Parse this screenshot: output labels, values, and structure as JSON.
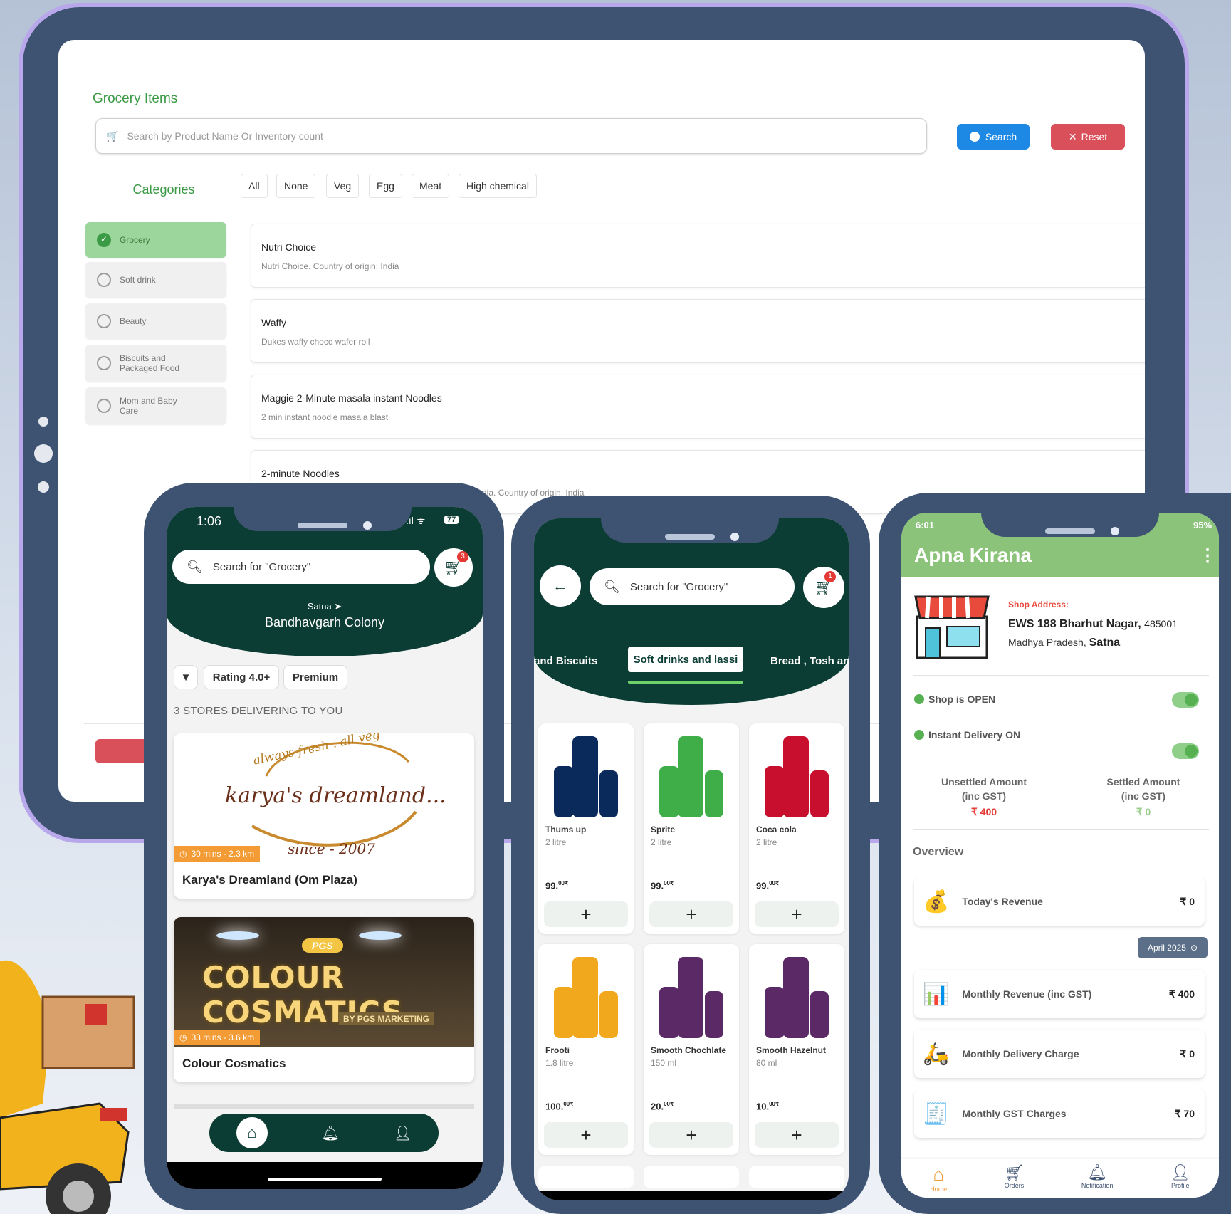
{
  "tablet": {
    "title": "Grocery Items",
    "search_placeholder": "Search by Product Name Or Inventory count",
    "search_button": "Search",
    "reset_button": "Reset",
    "categories_heading": "Categories",
    "categories": [
      {
        "label": "Grocery",
        "selected": true
      },
      {
        "label": "Soft drink",
        "selected": false
      },
      {
        "label": "Beauty",
        "selected": false
      },
      {
        "label": "Biscuits and Packaged Food",
        "selected": false
      },
      {
        "label": "Mom and Baby Care",
        "selected": false
      }
    ],
    "filter_chips": [
      "All",
      "None",
      "Veg",
      "Egg",
      "Meat",
      "High chemical"
    ],
    "products": [
      {
        "name": "Nutri Choice",
        "desc": "Nutri Choice. Country of origin: India"
      },
      {
        "name": "Waffy",
        "desc": "Dukes waffy choco wafer roll"
      },
      {
        "name": "Maggie 2-Minute masala instant Noodles",
        "desc": "2 min instant noodle masala blast"
      },
      {
        "name": "2-minute Noodles",
        "desc": "India. Country of origin: India"
      }
    ]
  },
  "phone1": {
    "time": "1:06",
    "battery": "77",
    "search_placeholder": "Search for \"Grocery\"",
    "cart_count": "3",
    "city": "Satna",
    "locality": "Bandhavgarh Colony",
    "filters": [
      "Rating 4.0+",
      "Premium"
    ],
    "stores_heading": "3 STORES DELIVERING TO YOU",
    "stores": [
      {
        "name": "Karya's Dreamland (Om Plaza)",
        "eta": "30 mins - 2.3 km",
        "logo_top": "always fresh . all veg",
        "logo_main": "karya's dreamland...",
        "logo_since": "since - 2007"
      },
      {
        "name": "Colour Cosmatics",
        "eta": "33 mins - 3.6 km",
        "sign_brand": "PGS",
        "sign_main": "COLOUR COSMATICS",
        "sign_sub": "BY PGS MARKETING"
      }
    ]
  },
  "phone2": {
    "search_placeholder": "Search for \"Grocery\"",
    "cart_count": "1",
    "tabs": [
      "and Biscuits",
      "Soft drinks and lassi",
      "Bread , Tosh and"
    ],
    "active_tab": "Soft drinks and lassi",
    "products": [
      {
        "name": "Thums up",
        "qty": "2 litre",
        "price": "99.",
        "sup": "00₹",
        "color": "#0b2a5c"
      },
      {
        "name": "Sprite",
        "qty": "2 litre",
        "price": "99.",
        "sup": "00₹",
        "color": "#3fae49"
      },
      {
        "name": "Coca cola",
        "qty": "2 litre",
        "price": "99.",
        "sup": "00₹",
        "color": "#c8102e"
      },
      {
        "name": "Frooti",
        "qty": "1.8 litre",
        "price": "100.",
        "sup": "00₹",
        "color": "#f2a81d"
      },
      {
        "name": "Smooth Chochlate",
        "qty": "150 ml",
        "price": "20.",
        "sup": "00₹",
        "color": "#5b2a66"
      },
      {
        "name": "Smooth Hazelnut",
        "qty": "80 ml",
        "price": "10.",
        "sup": "00₹",
        "color": "#5b2a66"
      }
    ]
  },
  "phone3": {
    "time": "6:01",
    "battery": "95%",
    "app_title": "Apna Kirana",
    "address_label": "Shop Address:",
    "address_line1": "EWS 188 Bharhut Nagar,",
    "pincode": "485001",
    "address_state": "Madhya Pradesh,",
    "address_city": "Satna",
    "shop_status": "Shop is OPEN",
    "delivery_status": "Instant Delivery ON",
    "unsettled_label": "Unsettled Amount",
    "unsettled_sub": "(inc GST)",
    "unsettled_value": "₹ 400",
    "settled_label": "Settled Amount",
    "settled_sub": "(inc GST)",
    "settled_value": "₹ 0",
    "overview_heading": "Overview",
    "today_label": "Today's Revenue",
    "today_value": "₹ 0",
    "month_selector": "April 2025",
    "monthly": [
      {
        "label": "Monthly Revenue (inc GST)",
        "value": "₹ 400"
      },
      {
        "label": "Monthly Delivery Charge",
        "value": "₹ 0"
      },
      {
        "label": "Monthly GST Charges",
        "value": "₹ 70"
      }
    ],
    "nav": [
      "Home",
      "Orders",
      "Notification",
      "Profile"
    ]
  },
  "colors": {
    "frame": "#3e5272",
    "frame_border": "#b8a7ea",
    "dark_green": "#0c3d34",
    "app_green": "#8cc37a",
    "accent_orange": "#f39c36"
  }
}
